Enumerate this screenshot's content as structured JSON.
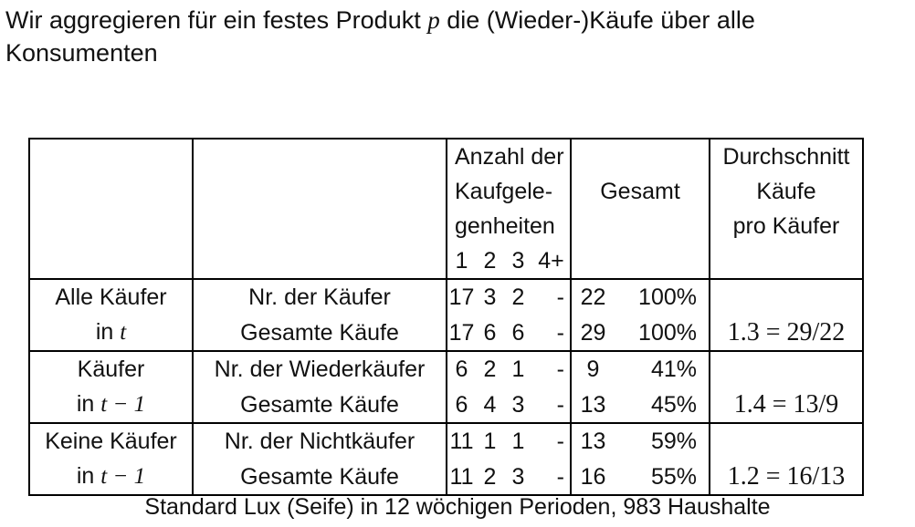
{
  "intro": {
    "text_before": "Wir aggregieren für ein festes Produkt ",
    "var": "p",
    "text_after": " die (Wieder-)Käufe über alle Konsumenten"
  },
  "header": {
    "anzahl_l1": "Anzahl der",
    "anzahl_l2": "Kaufgele-",
    "anzahl_l3": "genheiten",
    "cols": [
      "1",
      "2",
      "3",
      "4+"
    ],
    "gesamt": "Gesamt",
    "avg_l1": "Durchschnitt",
    "avg_l2": "Käufe",
    "avg_l3": "pro Käufer"
  },
  "groups": [
    {
      "label_l1": "Alle Käufer",
      "label_l2_pre": "in ",
      "label_l2_math": "t",
      "rows": [
        {
          "name": "Nr. der Käufer",
          "c1": "17",
          "c2": "3",
          "c3": "2",
          "c4": "-",
          "total": "22",
          "pct": "100%"
        },
        {
          "name": "Gesamte Käufe",
          "c1": "17",
          "c2": "6",
          "c3": "6",
          "c4": "-",
          "total": "29",
          "pct": "100%"
        }
      ],
      "avg": "1.3 = 29/22"
    },
    {
      "label_l1": "Käufer",
      "label_l2_pre": "in ",
      "label_l2_math": "t − 1",
      "rows": [
        {
          "name": "Nr. der Wiederkäufer",
          "c1": "6",
          "c2": "2",
          "c3": "1",
          "c4": "-",
          "total": "9",
          "pct": "41%"
        },
        {
          "name": "Gesamte Käufe",
          "c1": "6",
          "c2": "4",
          "c3": "3",
          "c4": "-",
          "total": "13",
          "pct": "45%"
        }
      ],
      "avg": "1.4 = 13/9"
    },
    {
      "label_l1": "Keine Käufer",
      "label_l2_pre": "in ",
      "label_l2_math": "t − 1",
      "rows": [
        {
          "name": "Nr. der Nichtkäufer",
          "c1": "11",
          "c2": "1",
          "c3": "1",
          "c4": "-",
          "total": "13",
          "pct": "59%"
        },
        {
          "name": "Gesamte Käufe",
          "c1": "11",
          "c2": "2",
          "c3": "3",
          "c4": "-",
          "total": "16",
          "pct": "55%"
        }
      ],
      "avg": "1.2 = 16/13"
    }
  ],
  "caption": "Standard Lux (Seife) in 12 wöchigen Perioden, 983 Haushalte"
}
